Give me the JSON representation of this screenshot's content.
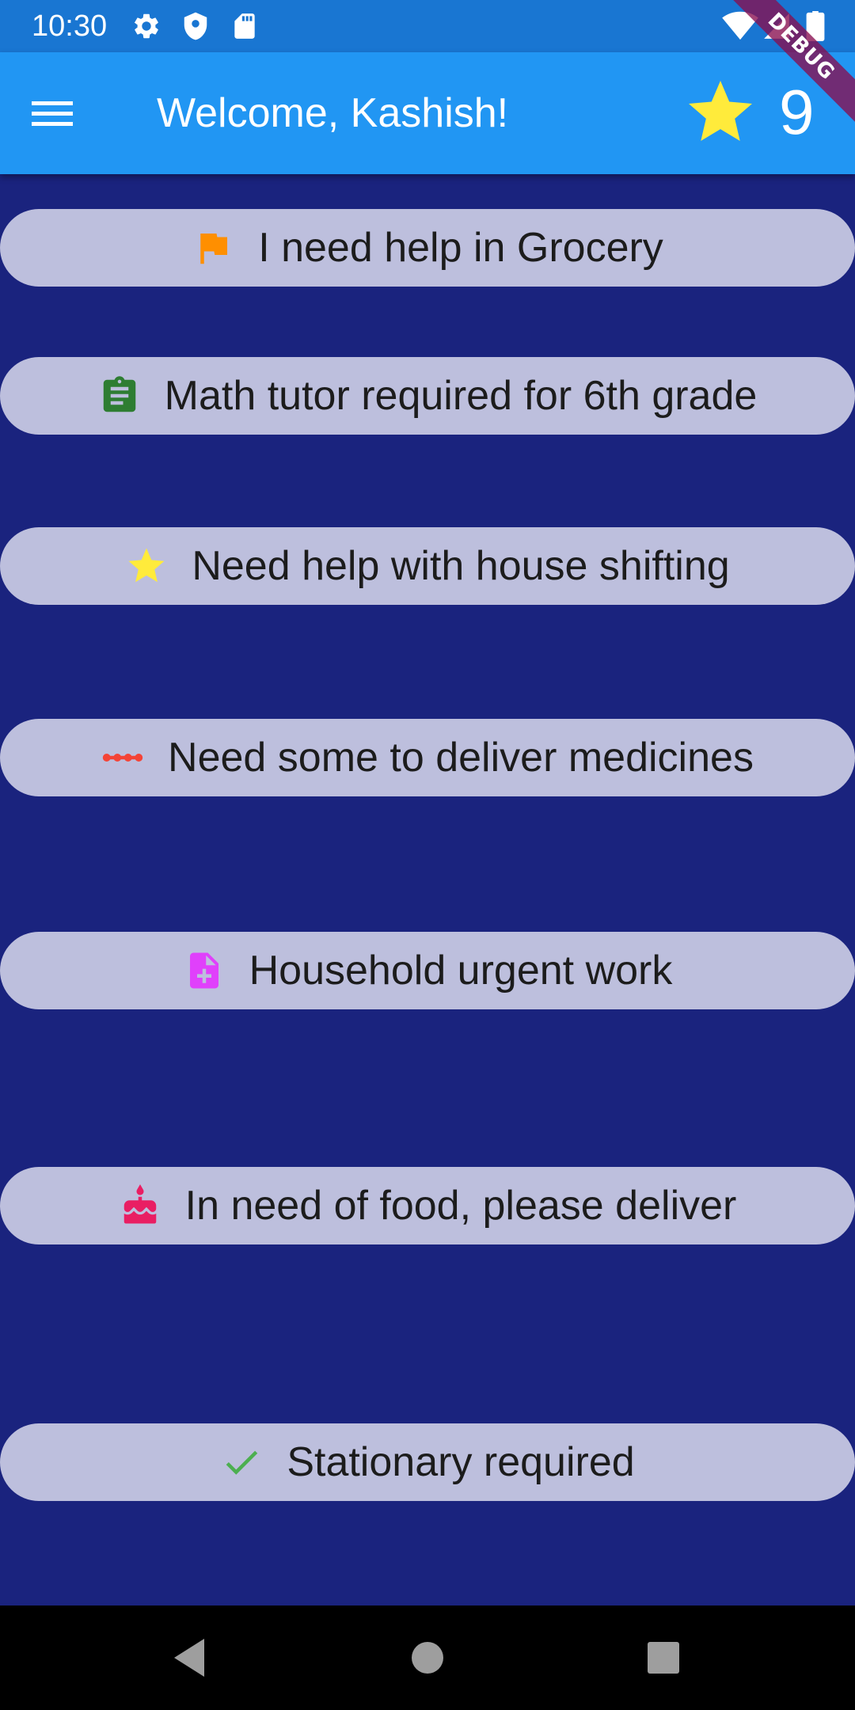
{
  "status_bar": {
    "time": "10:30",
    "icons": [
      "gear-icon",
      "shield-icon",
      "sd-card-icon",
      "wifi-icon",
      "signal-icon",
      "battery-icon"
    ]
  },
  "app_bar": {
    "title": "Welcome, Kashish!",
    "score": "9",
    "icons": [
      "menu-icon",
      "star-icon"
    ]
  },
  "debug_banner": "DEBUG",
  "requests": [
    {
      "label": "I need help in Grocery",
      "icon": "flag-icon",
      "icon_color": "#ff8f00"
    },
    {
      "label": "Math tutor required for 6th grade",
      "icon": "clipboard-icon",
      "icon_color": "#2e7d32"
    },
    {
      "label": "Need help with house shifting",
      "icon": "star-icon",
      "icon_color": "#ffeb3b"
    },
    {
      "label": "Need some to deliver medicines",
      "icon": "dotted-line-icon",
      "icon_color": "#f44336"
    },
    {
      "label": "Household urgent work",
      "icon": "note-add-icon",
      "icon_color": "#e040fb"
    },
    {
      "label": "In need of food, please deliver",
      "icon": "cake-icon",
      "icon_color": "#e91e63"
    },
    {
      "label": "Stationary required",
      "icon": "check-icon",
      "icon_color": "#4caf50"
    }
  ],
  "nav_bar": {
    "icons": [
      "back-icon",
      "home-icon",
      "recents-icon"
    ]
  },
  "colors": {
    "status_bar": "#1976d2",
    "app_bar": "#2196f3",
    "background": "#1a237e",
    "card": "#bdbfdd",
    "star": "#ffeb3b"
  }
}
